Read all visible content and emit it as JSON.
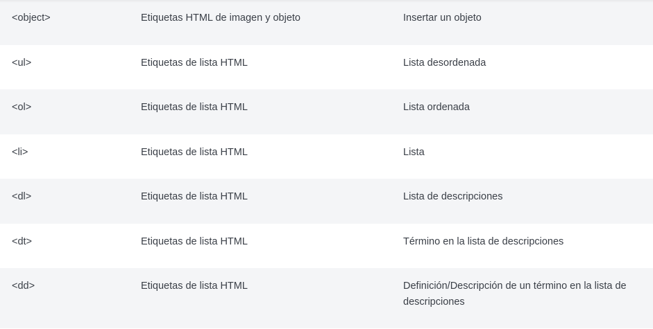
{
  "table": {
    "rows": [
      {
        "tag": "<object>",
        "category": "Etiquetas HTML de imagen y objeto",
        "description": "Insertar un objeto"
      },
      {
        "tag": "<ul>",
        "category": "Etiquetas de lista HTML",
        "description": "Lista desordenada"
      },
      {
        "tag": "<ol>",
        "category": "Etiquetas de lista HTML",
        "description": "Lista ordenada"
      },
      {
        "tag": "<li>",
        "category": "Etiquetas de lista HTML",
        "description": "Lista"
      },
      {
        "tag": "<dl>",
        "category": "Etiquetas de lista HTML",
        "description": "Lista de descripciones"
      },
      {
        "tag": "<dt>",
        "category": "Etiquetas de lista HTML",
        "description": "Término en la lista de descripciones"
      },
      {
        "tag": "<dd>",
        "category": "Etiquetas de lista HTML",
        "description": "Definición/Descripción de un término en la lista de descripciones"
      }
    ]
  },
  "colors": {
    "row_shaded": "#f4f5f7",
    "row_plain": "#ffffff",
    "text": "#3a3f47"
  }
}
